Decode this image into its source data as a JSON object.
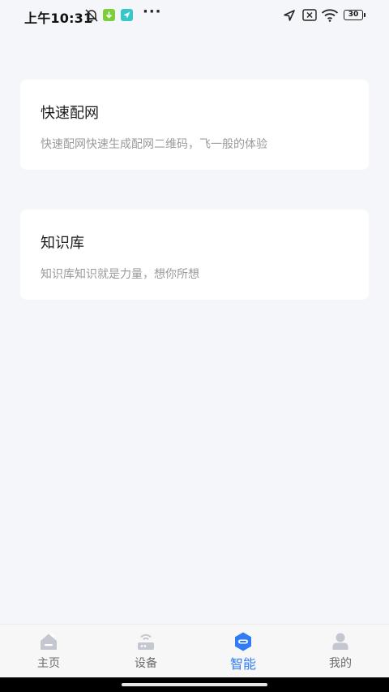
{
  "status_bar": {
    "time": "上午10:31",
    "battery": "30",
    "dots": "···"
  },
  "cards": [
    {
      "title": "快速配网",
      "description": "快速配网快速生成配网二维码，飞一般的体验"
    },
    {
      "title": "知识库",
      "description": "知识库知识就是力量，想你所想"
    }
  ],
  "bottom_nav": {
    "items": [
      {
        "label": "主页",
        "icon": "home-icon",
        "active": false
      },
      {
        "label": "设备",
        "icon": "router-icon",
        "active": false
      },
      {
        "label": "智能",
        "icon": "smart-icon",
        "active": true
      },
      {
        "label": "我的",
        "icon": "profile-icon",
        "active": false
      }
    ]
  },
  "colors": {
    "background": "#f5f6fa",
    "accent": "#2f7cf6",
    "inactive_icon": "#c4c7d0",
    "card": "#ffffff",
    "desc_text": "#9a9a9a"
  }
}
